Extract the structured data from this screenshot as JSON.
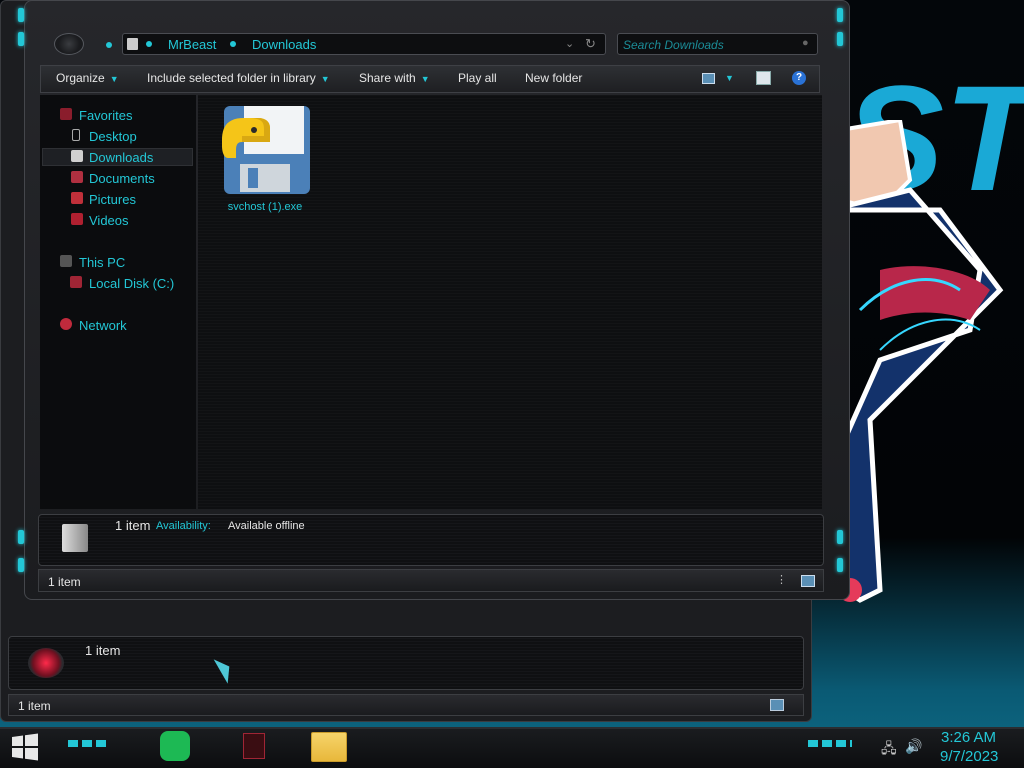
{
  "address": {
    "crumbs": [
      "MrBeast",
      "Downloads"
    ]
  },
  "search": {
    "placeholder": "Search Downloads"
  },
  "toolbar": {
    "organize": "Organize",
    "include_library": "Include selected folder in library",
    "share_with": "Share with",
    "play_all": "Play all",
    "new_folder": "New folder"
  },
  "nav": {
    "favorites": "Favorites",
    "desktop": "Desktop",
    "downloads": "Downloads",
    "documents": "Documents",
    "pictures": "Pictures",
    "videos": "Videos",
    "this_pc": "This PC",
    "local_disk": "Local Disk (C:)",
    "network": "Network"
  },
  "file": {
    "name": "svchost (1).exe"
  },
  "details": {
    "count": "1 item",
    "availability_label": "Availability:",
    "availability_value": "Available offline"
  },
  "status": {
    "count": "1 item"
  },
  "bg_window": {
    "details_count": "1 item",
    "status_count": "1 item"
  },
  "wallpaper": {
    "text": "ST"
  },
  "clock": {
    "time": "3:26 AM",
    "date": "9/7/2023"
  },
  "colors": {
    "accent": "#23c7d6",
    "background": "#000000"
  }
}
